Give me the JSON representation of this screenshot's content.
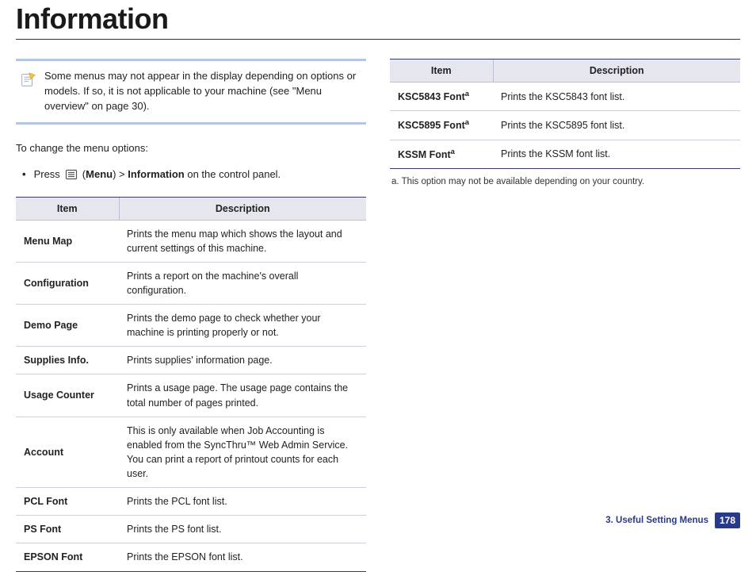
{
  "title": "Information",
  "note": "Some menus may not appear in the display depending on options or models. If so, it is not applicable to your machine (see \"Menu overview\" on page 30).",
  "intro": "To change the menu options:",
  "step_prefix": "Press",
  "step_menu_bold": "Menu",
  "step_mid": ") > ",
  "step_info_bold": "Information",
  "step_suffix": " on the control panel.",
  "table_headers": {
    "item": "Item",
    "desc": "Description"
  },
  "left_table": [
    {
      "item": "Menu Map",
      "desc": "Prints the menu map which shows the layout and current settings of this machine."
    },
    {
      "item": "Configuration",
      "desc": "Prints a report on the machine's overall configuration."
    },
    {
      "item": "Demo Page",
      "desc": "Prints the demo page to check whether your machine is printing properly or not."
    },
    {
      "item": "Supplies Info.",
      "desc": "Prints supplies' information page."
    },
    {
      "item": "Usage Counter",
      "desc": "Prints a usage page. The usage page contains the total number of pages printed."
    },
    {
      "item": "Account",
      "desc": "This is only available when Job Accounting is enabled from the SyncThru™ Web Admin Service. You can print a report of printout counts for each user."
    },
    {
      "item": "PCL Font",
      "desc": "Prints the PCL font list."
    },
    {
      "item": "PS Font",
      "desc": "Prints the PS font list."
    },
    {
      "item": "EPSON Font",
      "desc": "Prints the EPSON font list."
    }
  ],
  "right_table": [
    {
      "item": "KSC5843 Font",
      "sup": "a",
      "desc": "Prints the KSC5843 font list."
    },
    {
      "item": "KSC5895 Font",
      "sup": "a",
      "desc": "Prints the KSC5895 font list."
    },
    {
      "item": "KSSM Font",
      "sup": "a",
      "desc": "Prints the KSSM font list."
    }
  ],
  "footnote": "a.  This option may not be available depending on your country.",
  "footer": {
    "chapter": "3.  Useful Setting Menus",
    "page": "178"
  }
}
